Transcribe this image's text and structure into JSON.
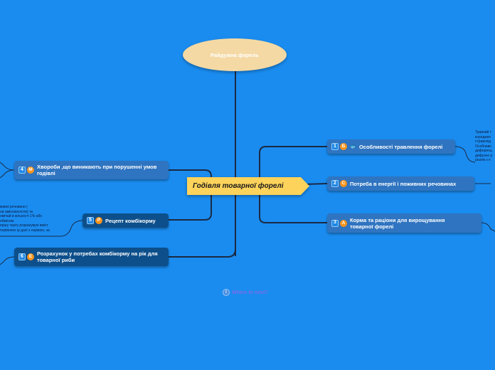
{
  "root": {
    "title": "Райдужна форель"
  },
  "central": {
    "title": "Годівля товарної форелі"
  },
  "branches": [
    {
      "num": "1",
      "letter": "Б",
      "icon": "fish-icon",
      "label": "Особливості травлення форелі"
    },
    {
      "num": "2",
      "letter": "С",
      "label": "Потреба в енергії і поживних речовинах"
    },
    {
      "num": "3",
      "letter": "А",
      "label": "Корма та раціони для вирощування товарної форелі"
    },
    {
      "num": "4",
      "letter": "М",
      "label": "Хвороби ,що виникають при порушенні умов годівлі"
    },
    {
      "num": "5",
      "letter": "Р",
      "label": "Рецепт комбікорму"
    },
    {
      "num": "6",
      "letter": "Е",
      "label": "Розрахунок у потребах комбікорму на рік для товарної риби"
    }
  ],
  "notes": {
    "right_note": "Травний т\nкороджих\nстравохід\nОсобливо\nдиференц\nдифузне р\nразом з п",
    "left_note": "живні речовини (\nни амінокислоти) та\nомічай в кількості 1% або\nобміном.\nершу чергу розрахувую вміст\nпорівнюю ці дані з нормою, за"
  },
  "footer": {
    "label": "Where to next?"
  },
  "colors": {
    "background": "#1a8cf0",
    "root": "#f4d9a4",
    "central": "#fdd35b",
    "branch_light": "#2f74c0",
    "branch_dark": "#0d4f8b"
  }
}
